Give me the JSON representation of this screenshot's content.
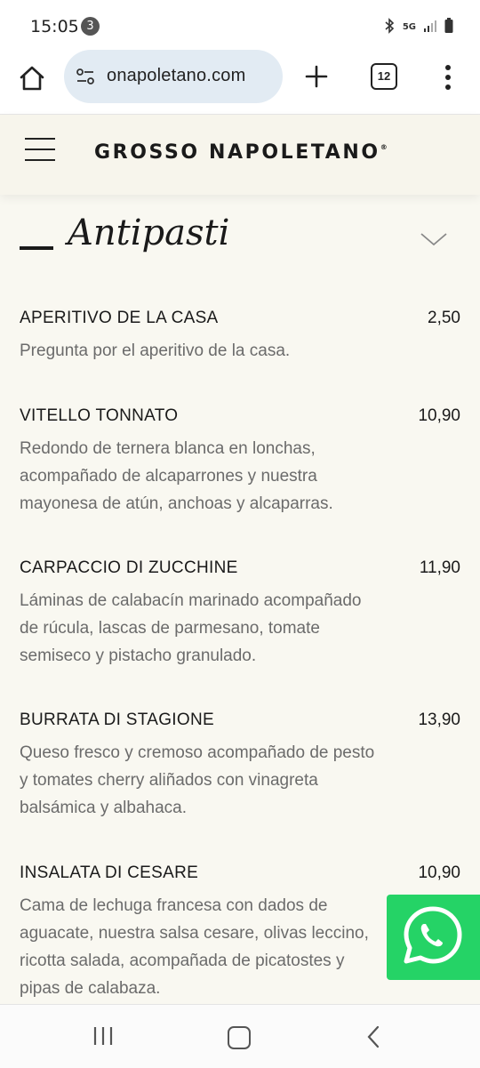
{
  "status_bar": {
    "time": "15:05",
    "notification_count": "3",
    "network": "5G"
  },
  "browser": {
    "url": "onapoletano.com",
    "tab_count": "12"
  },
  "site": {
    "brand": "GROSSO NAPOLETANO",
    "brand_mark": "®"
  },
  "section": {
    "title": "Antipasti"
  },
  "menu_items": [
    {
      "name": "APERITIVO DE LA CASA",
      "price": "2,50",
      "description": "Pregunta por el aperitivo de la casa."
    },
    {
      "name": "VITELLO TONNATO",
      "price": "10,90",
      "description": "Redondo de ternera blanca en lonchas,\nacompañado de alcaparrones y nuestra\nmayonesa de atún, anchoas y alcaparras."
    },
    {
      "name": "CARPACCIO DI ZUCCHINE",
      "price": "11,90",
      "description": "Láminas de calabacín marinado acompañado\nde rúcula, lascas de parmesano, tomate\nsemiseco y pistacho granulado."
    },
    {
      "name": "BURRATA DI STAGIONE",
      "price": "13,90",
      "description": "Queso fresco y cremoso acompañado de pesto\ny tomates cherry aliñados con vinagreta\nbalsámica y albahaca."
    },
    {
      "name": "INSALATA DI CESARE",
      "price": "10,90",
      "description": "Cama de lechuga francesa con dados de\naguacate, nuestra salsa cesare, olivas leccino,\nricotta salada, acompañada de picatostes y\npipas de calabaza."
    }
  ],
  "colors": {
    "page_bg": "#f9f8f1",
    "header_bg": "#f7f5ec",
    "url_pill": "#e2ebf3",
    "whatsapp": "#25d366",
    "text_muted": "#6b6b6b"
  }
}
